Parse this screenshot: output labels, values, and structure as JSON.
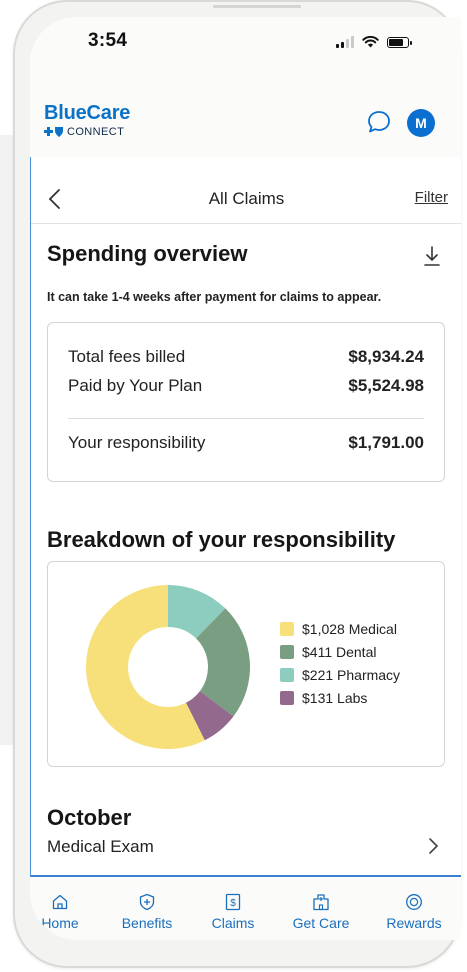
{
  "status_bar": {
    "time": "3:54"
  },
  "header": {
    "logo_text": "BlueCare",
    "logo_sub": "CONNECT",
    "avatar_initial": "M"
  },
  "nav": {
    "title": "All Claims",
    "filter_label": "Filter"
  },
  "spending": {
    "title": "Spending overview",
    "notice": "It can take 1-4 weeks after payment for claims to appear.",
    "rows": [
      {
        "label": "Total fees billed",
        "amount": "$8,934.24"
      },
      {
        "label": "Paid by Your Plan",
        "amount": "$5,524.98"
      }
    ],
    "responsibility": {
      "label": "Your responsibility",
      "amount": "$1,791.00"
    }
  },
  "breakdown": {
    "title": "Breakdown of your responsibility",
    "legend": [
      {
        "label": "$1,028 Medical",
        "color": "#f7e07a"
      },
      {
        "label": "$411 Dental",
        "color": "#7a9e82"
      },
      {
        "label": "$221 Pharmacy",
        "color": "#8dcdc0"
      },
      {
        "label": "$131 Labs",
        "color": "#936a8d"
      }
    ]
  },
  "chart_data": {
    "type": "pie",
    "categories": [
      "Medical",
      "Dental",
      "Pharmacy",
      "Labs"
    ],
    "values": [
      1028,
      411,
      221,
      131
    ],
    "colors": [
      "#f7e07a",
      "#7a9e82",
      "#8dcdc0",
      "#936a8d"
    ],
    "donut": true,
    "legend_position": "right"
  },
  "october": {
    "title": "October",
    "items": [
      {
        "label": "Medical Exam"
      }
    ]
  },
  "tabbar": {
    "tabs": [
      {
        "label": "Home",
        "icon": "home-icon"
      },
      {
        "label": "Benefits",
        "icon": "shield-icon"
      },
      {
        "label": "Claims",
        "icon": "dollar-icon"
      },
      {
        "label": "Get Care",
        "icon": "building-icon"
      },
      {
        "label": "Rewards",
        "icon": "rewards-icon"
      }
    ],
    "accent": "#1a6fbd"
  }
}
